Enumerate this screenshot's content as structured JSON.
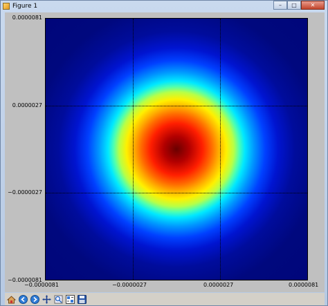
{
  "window": {
    "title": "Figure 1",
    "controls": {
      "minimize_icon": "minimize-icon",
      "maximize_icon": "maximize-icon",
      "close_icon": "close-icon"
    }
  },
  "toolbar": {
    "items": [
      {
        "name": "home",
        "icon": "home-icon"
      },
      {
        "name": "back",
        "icon": "back-arrow-icon"
      },
      {
        "name": "forward",
        "icon": "forward-arrow-icon"
      },
      {
        "name": "pan",
        "icon": "pan-move-icon"
      },
      {
        "name": "zoom",
        "icon": "zoom-rect-icon"
      },
      {
        "name": "configure-subplots",
        "icon": "subplots-icon"
      },
      {
        "name": "save",
        "icon": "save-icon"
      }
    ]
  },
  "chart_data": {
    "type": "heatmap",
    "title": "",
    "xlabel": "",
    "ylabel": "",
    "colormap": "jet",
    "grid": true,
    "xlim": [
      -8.1e-06,
      8.1e-06
    ],
    "ylim": [
      -8.1e-06,
      8.1e-06
    ],
    "x_ticks": [
      "−0.0000081",
      "−0.0000027",
      "0.0000027",
      "0.0000081"
    ],
    "y_ticks": [
      "0.0000081",
      "0.0000027",
      "−0.0000027",
      "−0.0000081"
    ],
    "description_values": {
      "peak_center": [
        0.0,
        0.0
      ],
      "distribution": "2D Gaussian intensity, peak at center, falling to background at edges"
    }
  }
}
